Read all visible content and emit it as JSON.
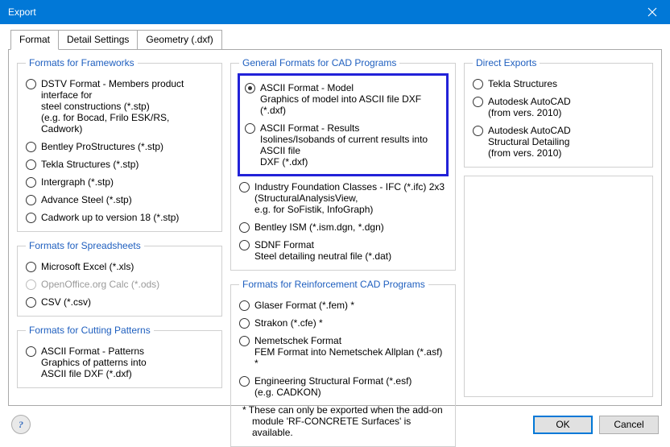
{
  "window": {
    "title": "Export"
  },
  "tabs": {
    "t0": "Format",
    "t1": "Detail Settings",
    "t2": "Geometry (.dxf)"
  },
  "frameworks": {
    "legend": "Formats for Frameworks",
    "o0l1": "DSTV Format - Members product interface for",
    "o0l2": "steel constructions (*.stp)",
    "o0l3": "(e.g. for Bocad, Frilo ESK/RS, Cadwork)",
    "o1": "Bentley ProStructures (*.stp)",
    "o2": "Tekla Structures (*.stp)",
    "o3": "Intergraph (*.stp)",
    "o4": "Advance Steel (*.stp)",
    "o5": "Cadwork up to version 18 (*.stp)"
  },
  "spreadsheets": {
    "legend": "Formats for Spreadsheets",
    "o0": "Microsoft Excel (*.xls)",
    "o1": "OpenOffice.org Calc (*.ods)",
    "o2": "CSV (*.csv)"
  },
  "cutting": {
    "legend": "Formats for  Cutting Patterns",
    "o0l1": "ASCII Format - Patterns",
    "o0l2": "Graphics of patterns into",
    "o0l3": "ASCII file DXF (*.dxf)"
  },
  "cad": {
    "legend": "General Formats for CAD Programs",
    "o0l1": "ASCII Format - Model",
    "o0l2": "Graphics of model into ASCII file DXF (*.dxf)",
    "o1l1": "ASCII Format - Results",
    "o1l2": "Isolines/Isobands of current results into ASCII file",
    "o1l3": "DXF (*.dxf)",
    "o2l1": "Industry Foundation Classes - IFC (*.ifc) 2x3",
    "o2l2": "(StructuralAnalysisView,",
    "o2l3": "e.g. for SoFistik, InfoGraph)",
    "o3": "Bentley ISM (*.ism.dgn, *.dgn)",
    "o4l1": "SDNF Format",
    "o4l2": "Steel detailing neutral file (*.dat)"
  },
  "reinf": {
    "legend": "Formats for Reinforcement CAD Programs",
    "o0": "Glaser Format  (*.fem)  *",
    "o1": "Strakon (*.cfe)  *",
    "o2l1": "Nemetschek Format",
    "o2l2": "FEM Format into Nemetschek Allplan (*.asf)  *",
    "o3l1": "Engineering Structural Format (*.esf)",
    "o3l2": "(e.g. CADKON)",
    "note1": "*  These can only be exported when the add-on",
    "note2": "module 'RF-CONCRETE Surfaces' is available."
  },
  "direct": {
    "legend": "Direct Exports",
    "o0": "Tekla Structures",
    "o1l1": "Autodesk AutoCAD",
    "o1l2": "(from vers. 2010)",
    "o2l1": "Autodesk AutoCAD",
    "o2l2": "Structural Detailing",
    "o2l3": "(from vers. 2010)"
  },
  "buttons": {
    "ok": "OK",
    "cancel": "Cancel"
  }
}
